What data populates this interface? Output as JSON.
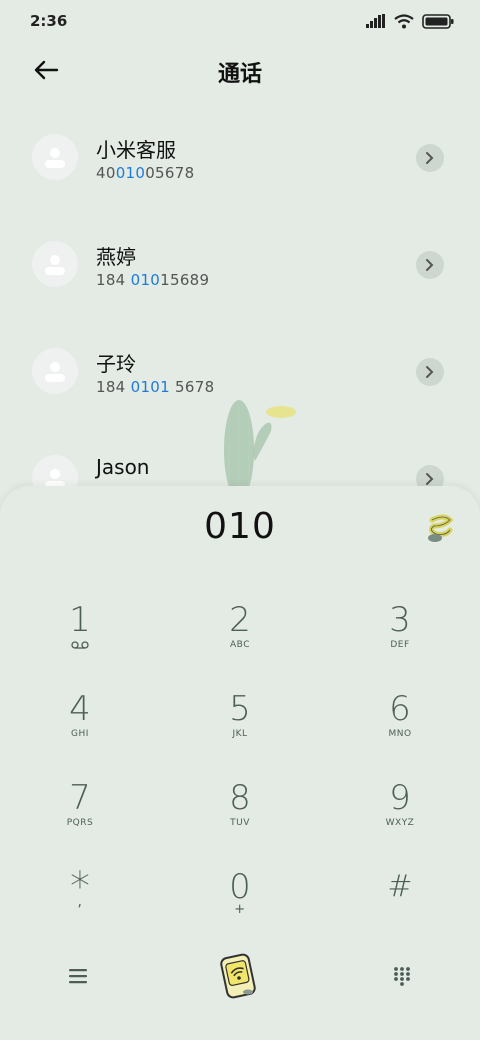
{
  "status": {
    "time": "2:36"
  },
  "header": {
    "title": "通话"
  },
  "contacts": [
    {
      "name": "小米客服",
      "number_pre": "40",
      "number_hl": "010",
      "number_post": "05678"
    },
    {
      "name": "燕婷",
      "number_pre": "184 ",
      "number_hl": "010",
      "number_post": "15689"
    },
    {
      "name": "子玲",
      "number_pre": "184 ",
      "number_hl": "0101",
      "number_post": " 5678"
    },
    {
      "name": "Jason",
      "number_pre": "",
      "number_hl": "",
      "number_post": ""
    }
  ],
  "dialer": {
    "number": "010",
    "keys": [
      {
        "digit": "1",
        "letters": ""
      },
      {
        "digit": "2",
        "letters": "ABC"
      },
      {
        "digit": "3",
        "letters": "DEF"
      },
      {
        "digit": "4",
        "letters": "GHI"
      },
      {
        "digit": "5",
        "letters": "JKL"
      },
      {
        "digit": "6",
        "letters": "MNO"
      },
      {
        "digit": "7",
        "letters": "PQRS"
      },
      {
        "digit": "8",
        "letters": "TUV"
      },
      {
        "digit": "9",
        "letters": "WXYZ"
      },
      {
        "digit": "*",
        "letters": ","
      },
      {
        "digit": "0",
        "letters": "+"
      },
      {
        "digit": "#",
        "letters": ""
      }
    ]
  },
  "icons": {
    "back": "back-arrow-icon",
    "menu": "menu-icon",
    "call": "call-icon",
    "keypad": "keypad-grid-icon",
    "voicemail": "voicemail-icon"
  },
  "colors": {
    "background": "#e3ebe4",
    "highlight": "#1e7bdc",
    "key_text": "#4b5e57"
  }
}
